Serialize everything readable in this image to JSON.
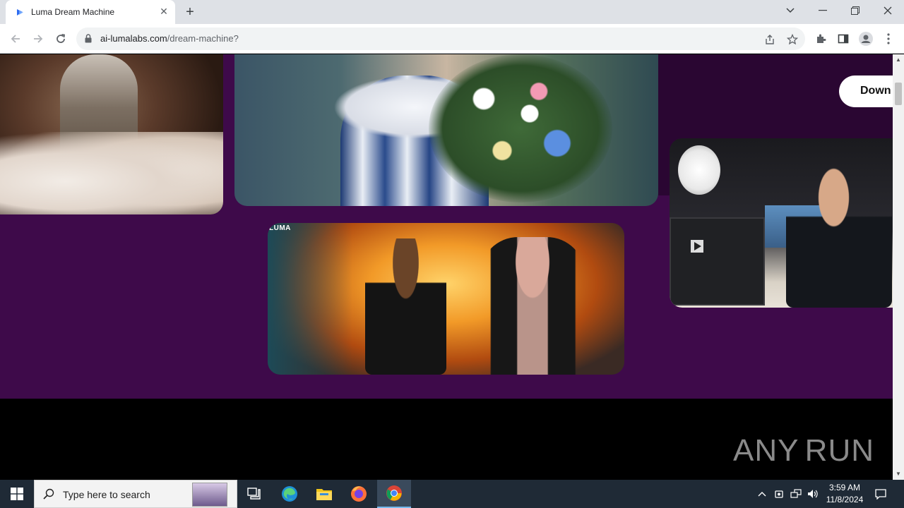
{
  "browser": {
    "tab_title": "Luma Dream Machine",
    "tab_close_glyph": "✕",
    "new_tab_glyph": "+",
    "url_host": "ai-lumalabs.com",
    "url_path": "/dream-machine?",
    "icons": [
      "back-icon",
      "forward-icon",
      "reload-icon",
      "lock-icon",
      "share-icon",
      "star-icon",
      "extensions-icon",
      "side-panel-icon",
      "profile-icon",
      "menu-icon"
    ]
  },
  "page": {
    "download_label": "Down",
    "watermark": "LUMA",
    "colors": {
      "purple": "#3e0a4a",
      "dark_purple": "#2a0632",
      "footer": "#000000"
    }
  },
  "overlay": {
    "brand_left": "ANY",
    "brand_right": "RUN"
  },
  "taskbar": {
    "search_placeholder": "Type here to search",
    "time": "3:59 AM",
    "date": "11/8/2024",
    "apps": [
      "task-view-icon",
      "edge-icon",
      "file-explorer-icon",
      "firefox-icon",
      "chrome-icon"
    ]
  }
}
